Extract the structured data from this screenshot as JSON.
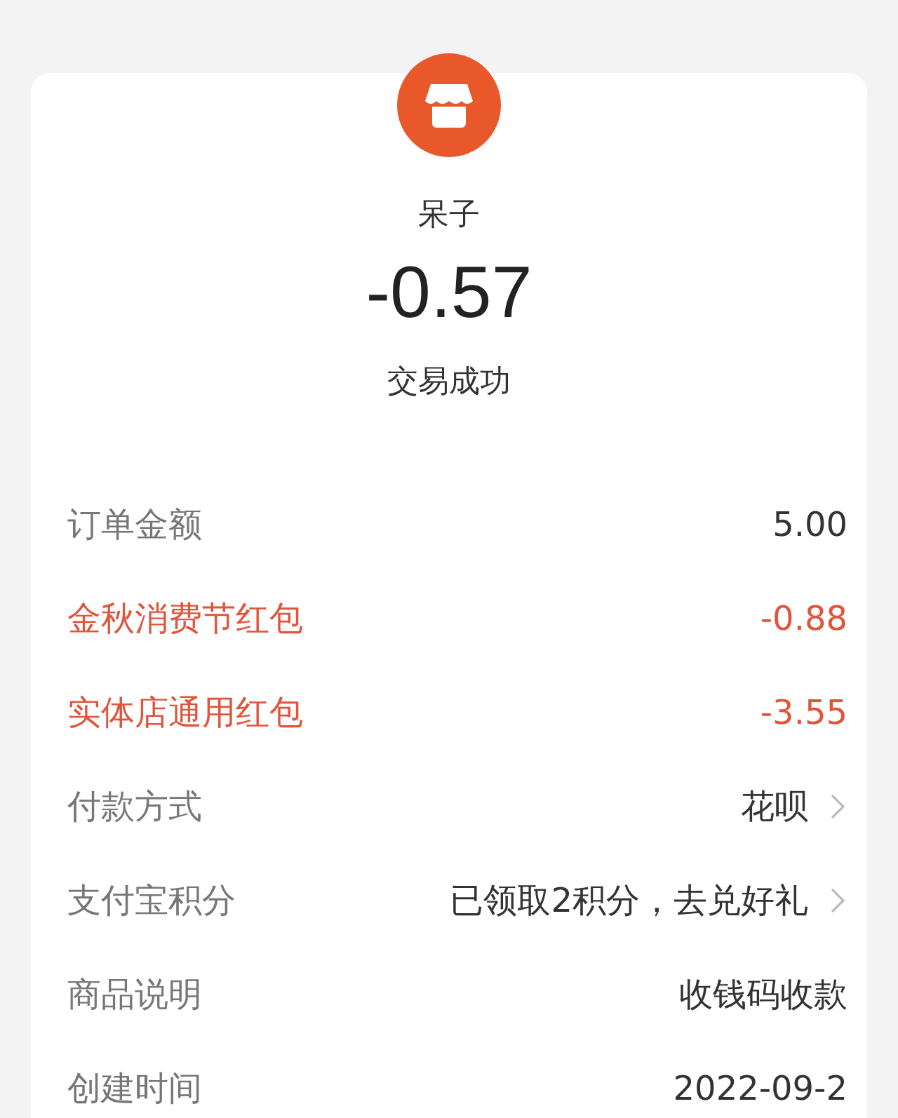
{
  "merchant": {
    "name": "呆子",
    "amount": "-0.57",
    "status": "交易成功"
  },
  "details": [
    {
      "label": "订单金额",
      "value": "5.00",
      "highlight": false,
      "link": false
    },
    {
      "label": "金秋消费节红包",
      "value": "-0.88",
      "highlight": true,
      "link": false
    },
    {
      "label": "实体店通用红包",
      "value": "-3.55",
      "highlight": true,
      "link": false
    },
    {
      "label": "付款方式",
      "value": "花呗",
      "highlight": false,
      "link": true
    },
    {
      "label": "支付宝积分",
      "value": "已领取2积分，去兑好礼",
      "highlight": false,
      "link": true
    },
    {
      "label": "商品说明",
      "value": "收钱码收款",
      "highlight": false,
      "link": false
    },
    {
      "label": "创建时间",
      "value": "2022-09-2",
      "highlight": false,
      "link": false
    }
  ]
}
